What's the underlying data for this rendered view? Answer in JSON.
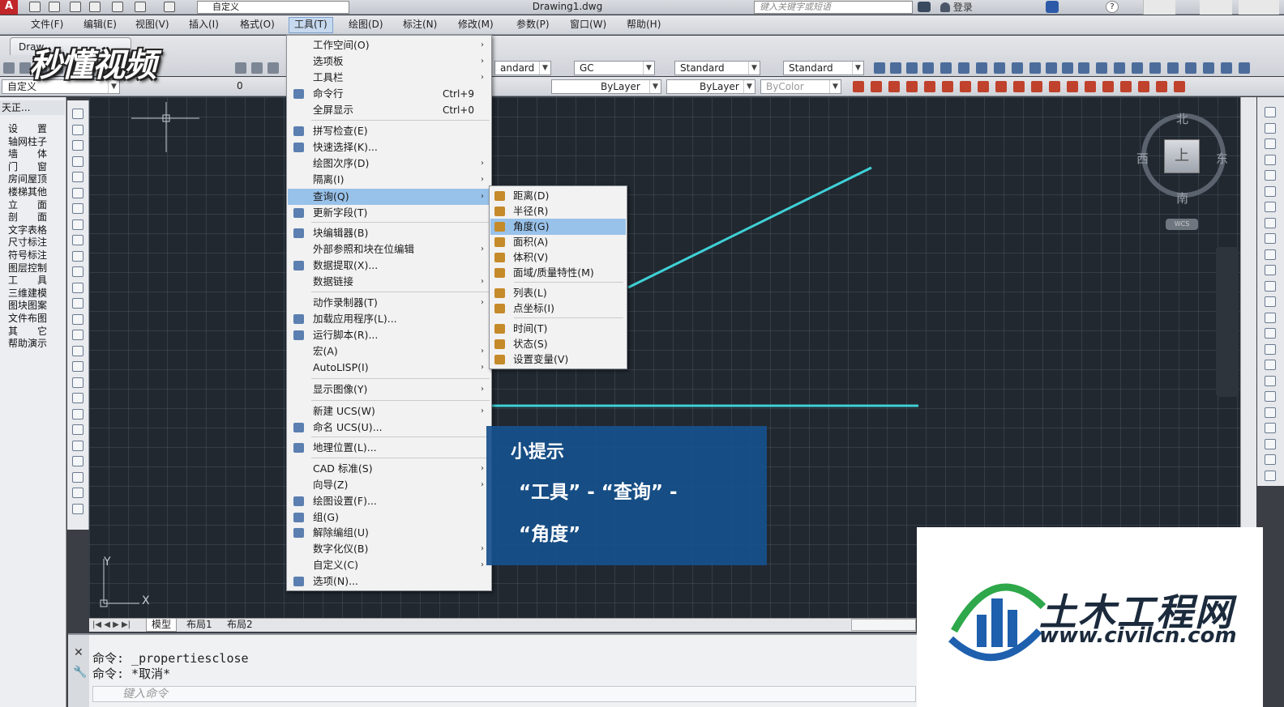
{
  "titlebar": {
    "workspace": "自定义",
    "document_title": "Drawing1.dwg",
    "search_placeholder": "键入关键字或短语",
    "login": "登录"
  },
  "menubar": [
    "文件(F)",
    "编辑(E)",
    "视图(V)",
    "插入(I)",
    "格式(O)",
    "工具(T)",
    "绘图(D)",
    "标注(N)",
    "修改(M)",
    "参数(P)",
    "窗口(W)",
    "帮助(H)"
  ],
  "file_tab": "Draw",
  "toolbar": {
    "text_style": "andard",
    "dim_style": "GC",
    "table_style": "Standard",
    "mleader_style": "Standard",
    "workspace2": "自定义",
    "layer": "0",
    "color": "ByLayer",
    "linetype": "ByLayer",
    "plotstyle": "ByColor"
  },
  "left_palette": {
    "title": "天正...",
    "items": [
      "设　　置",
      "轴网柱子",
      "墙　　体",
      "门　　窗",
      "房间屋顶",
      "楼梯其他",
      "立　　面",
      "剖　　面",
      "文字表格",
      "尺寸标注",
      "符号标注",
      "图层控制",
      "工　　具",
      "三维建模",
      "图块图案",
      "文件布图",
      "其　　它",
      "帮助演示"
    ]
  },
  "tools_menu": [
    {
      "label": "工作空间(O)",
      "submenu": true
    },
    {
      "label": "选项板",
      "submenu": true
    },
    {
      "label": "工具栏",
      "submenu": true
    },
    {
      "label": "命令行",
      "shortcut": "Ctrl+9",
      "icon": "command-line-icon"
    },
    {
      "label": "全屏显示",
      "shortcut": "Ctrl+0"
    },
    {
      "label": "拼写检查(E)",
      "icon": "spell-check-icon"
    },
    {
      "label": "快速选择(K)...",
      "icon": "quick-select-icon"
    },
    {
      "label": "绘图次序(D)",
      "submenu": true
    },
    {
      "label": "隔离(I)",
      "submenu": true
    },
    {
      "label": "查询(Q)",
      "submenu": true,
      "highlighted": true
    },
    {
      "label": "更新字段(T)",
      "icon": "update-field-icon"
    },
    {
      "label": "块编辑器(B)",
      "icon": "block-editor-icon"
    },
    {
      "label": "外部参照和块在位编辑",
      "submenu": true
    },
    {
      "label": "数据提取(X)...",
      "icon": "data-extraction-icon"
    },
    {
      "label": "数据链接",
      "submenu": true
    },
    {
      "label": "动作录制器(T)",
      "submenu": true
    },
    {
      "label": "加载应用程序(L)...",
      "icon": "load-app-icon"
    },
    {
      "label": "运行脚本(R)...",
      "icon": "run-script-icon"
    },
    {
      "label": "宏(A)",
      "submenu": true
    },
    {
      "label": "AutoLISP(I)",
      "submenu": true
    },
    {
      "label": "显示图像(Y)",
      "submenu": true
    },
    {
      "label": "新建 UCS(W)",
      "submenu": true
    },
    {
      "label": "命名 UCS(U)...",
      "icon": "named-ucs-icon"
    },
    {
      "label": "地理位置(L)...",
      "icon": "geolocation-icon"
    },
    {
      "label": "CAD 标准(S)",
      "submenu": true
    },
    {
      "label": "向导(Z)",
      "submenu": true
    },
    {
      "label": "绘图设置(F)...",
      "icon": "drafting-settings-icon"
    },
    {
      "label": "组(G)",
      "icon": "group-icon"
    },
    {
      "label": "解除编组(U)",
      "icon": "ungroup-icon"
    },
    {
      "label": "数字化仪(B)",
      "submenu": true
    },
    {
      "label": "自定义(C)",
      "submenu": true
    },
    {
      "label": "选项(N)...",
      "icon": "options-icon"
    }
  ],
  "query_menu": [
    {
      "label": "距离(D)",
      "icon": "distance-icon"
    },
    {
      "label": "半径(R)",
      "icon": "radius-icon"
    },
    {
      "label": "角度(G)",
      "icon": "angle-icon",
      "highlighted": true
    },
    {
      "label": "面积(A)",
      "icon": "area-icon"
    },
    {
      "label": "体积(V)",
      "icon": "volume-icon"
    },
    {
      "label": "面域/质量特性(M)",
      "icon": "mass-properties-icon"
    },
    {
      "label": "列表(L)",
      "icon": "list-icon"
    },
    {
      "label": "点坐标(I)",
      "icon": "id-point-icon"
    },
    {
      "label": "时间(T)",
      "icon": "time-icon"
    },
    {
      "label": "状态(S)",
      "icon": "status-icon"
    },
    {
      "label": "设置变量(V)",
      "icon": "set-variable-icon"
    }
  ],
  "viewcube": {
    "north": "北",
    "south": "南",
    "east": "东",
    "west": "西",
    "face": "上",
    "wcs": "WCS"
  },
  "layout_tabs": [
    "模型",
    "布局1",
    "布局2"
  ],
  "ucs_labels": {
    "y": "Y",
    "x": "X"
  },
  "command": {
    "line1": "命令: _propertiesclose",
    "line2": "命令: *取消*",
    "placeholder": "键入命令"
  },
  "tip": {
    "title": "小提示",
    "line1": "“工具” - “查询” -",
    "line2": "“角度”"
  },
  "watermarks": {
    "brand": "秒懂视频",
    "logo_name": "土木工程网",
    "logo_url": "www.civilcn.com"
  },
  "colors": {
    "canvas": "#212830",
    "line": "#3fd1d6",
    "menu_highlight": "#99c2ea",
    "tip_bg": "#16508c"
  }
}
